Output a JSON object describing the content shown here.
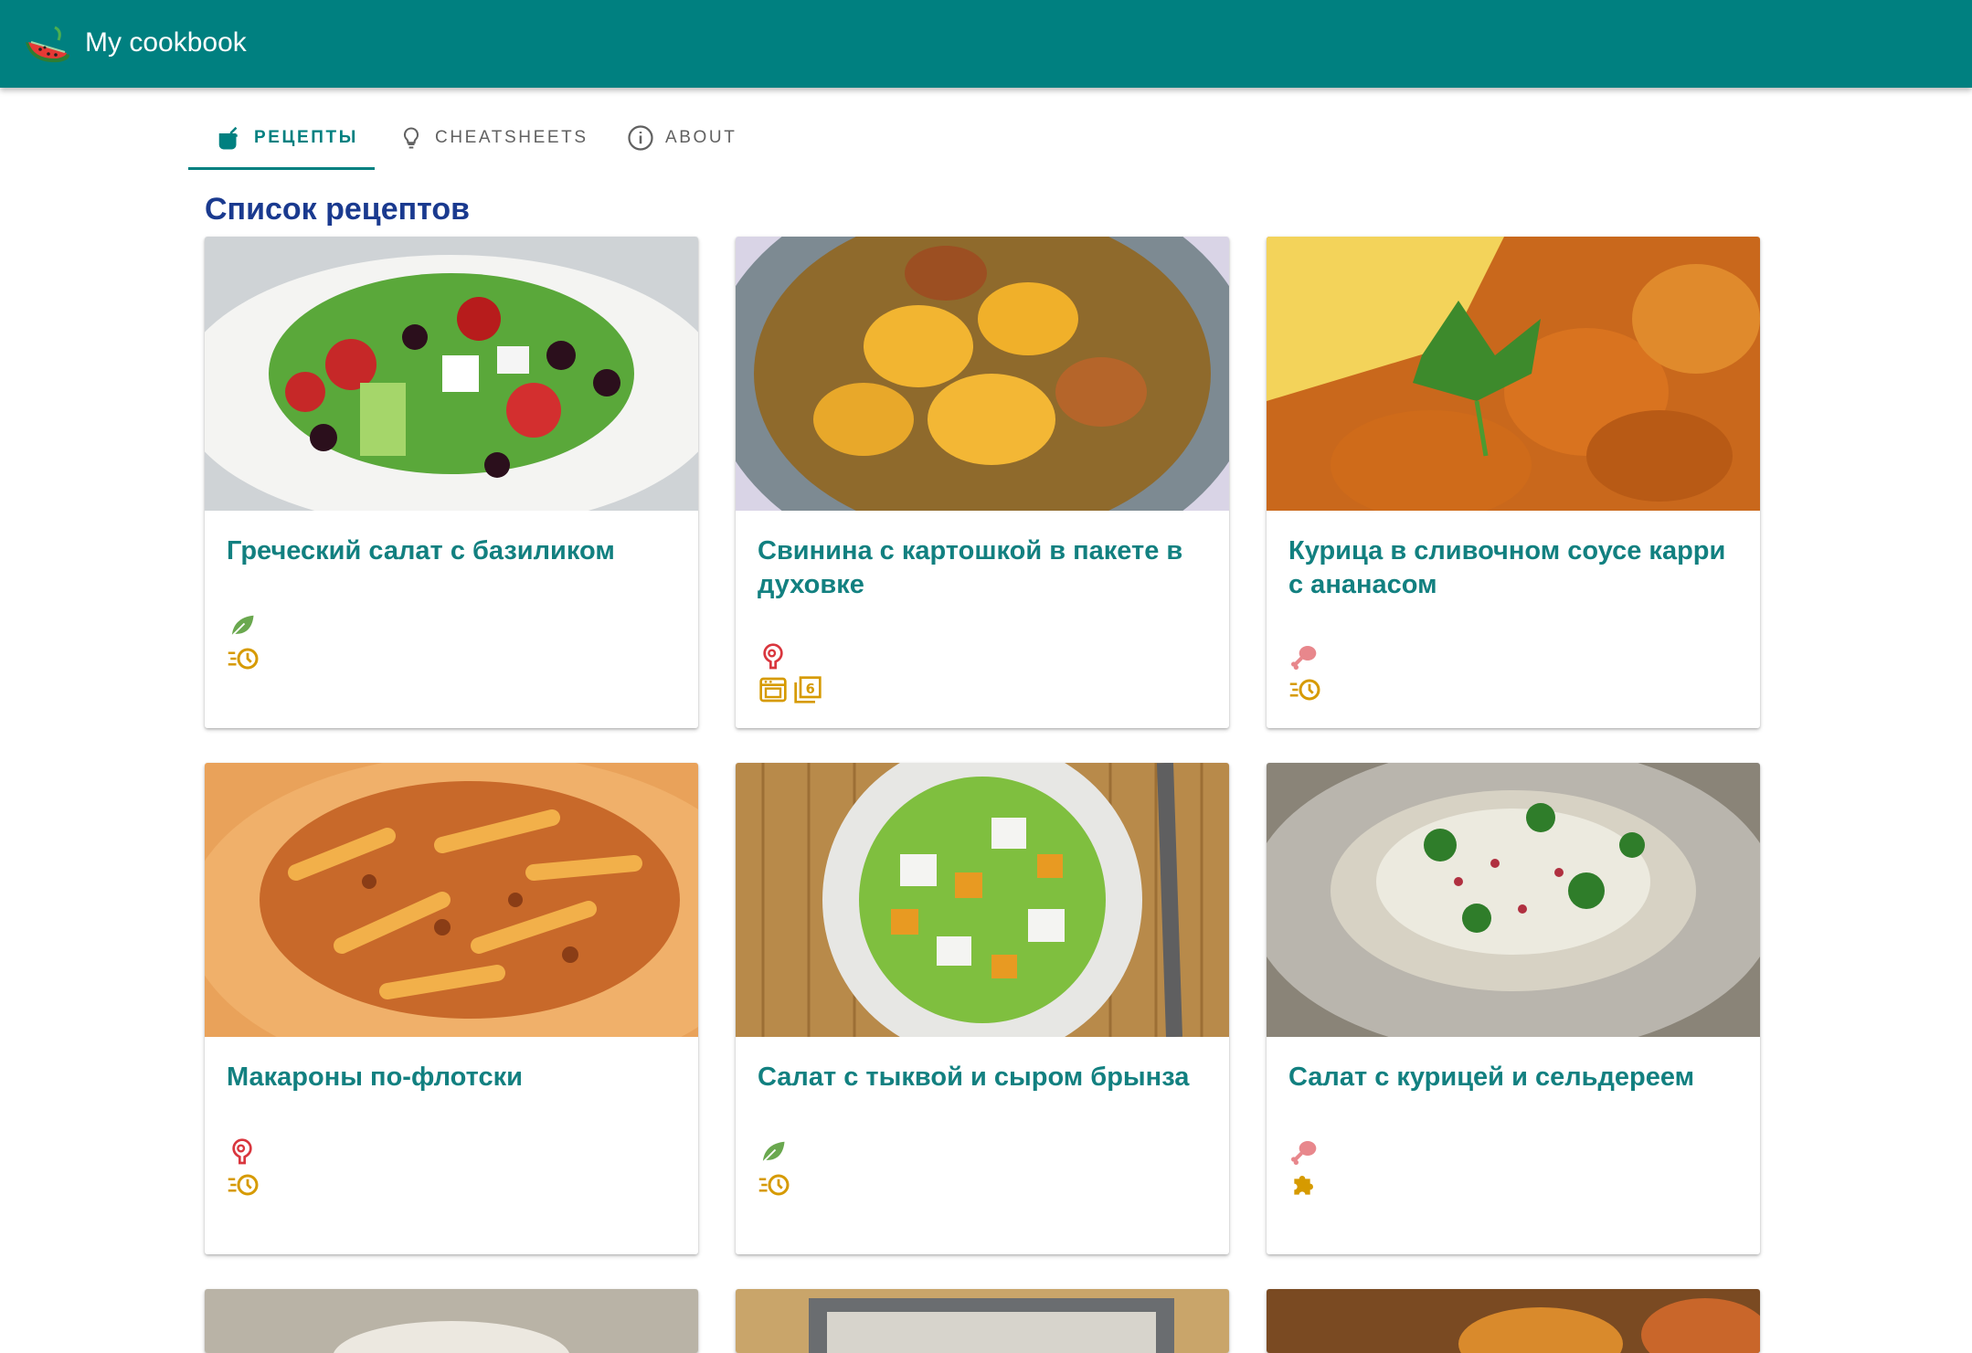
{
  "app": {
    "title": "My cookbook",
    "logo_icon": "watermelon-icon"
  },
  "tabs": [
    {
      "label": "РЕЦЕПТЫ",
      "icon": "pot-icon",
      "active": true
    },
    {
      "label": "CHEATSHEETS",
      "icon": "lightbulb-icon",
      "active": false
    },
    {
      "label": "ABOUT",
      "icon": "info-icon",
      "active": false
    }
  ],
  "page_title": "Список рецептов",
  "recipes": [
    {
      "name": "Греческий салат с базиликом",
      "icons": [
        "leaf-icon",
        "quick-time-icon"
      ]
    },
    {
      "name": "Свинина с картошкой в пакете в духовке",
      "icons": [
        "meat-icon",
        "oven-icon",
        "six-portions-icon"
      ]
    },
    {
      "name": "Курица в сливочном соусе карри с ананасом",
      "icons": [
        "chicken-leg-icon",
        "quick-time-icon"
      ]
    },
    {
      "name": "Макароны по-флотски",
      "icons": [
        "meat-icon",
        "quick-time-icon"
      ]
    },
    {
      "name": "Салат с тыквой и сыром брынза",
      "icons": [
        "leaf-icon",
        "quick-time-icon"
      ]
    },
    {
      "name": "Салат с курицей и сельдереем",
      "icons": [
        "chicken-leg-icon",
        "puzzle-icon"
      ]
    }
  ],
  "colors": {
    "appbar": "#008080",
    "title": "#1a3a8f",
    "recipe_name": "#128080",
    "leaf": "#6aa84f",
    "meat": "#d9363e",
    "chicken": "#e8878c",
    "time": "#d69a00"
  }
}
